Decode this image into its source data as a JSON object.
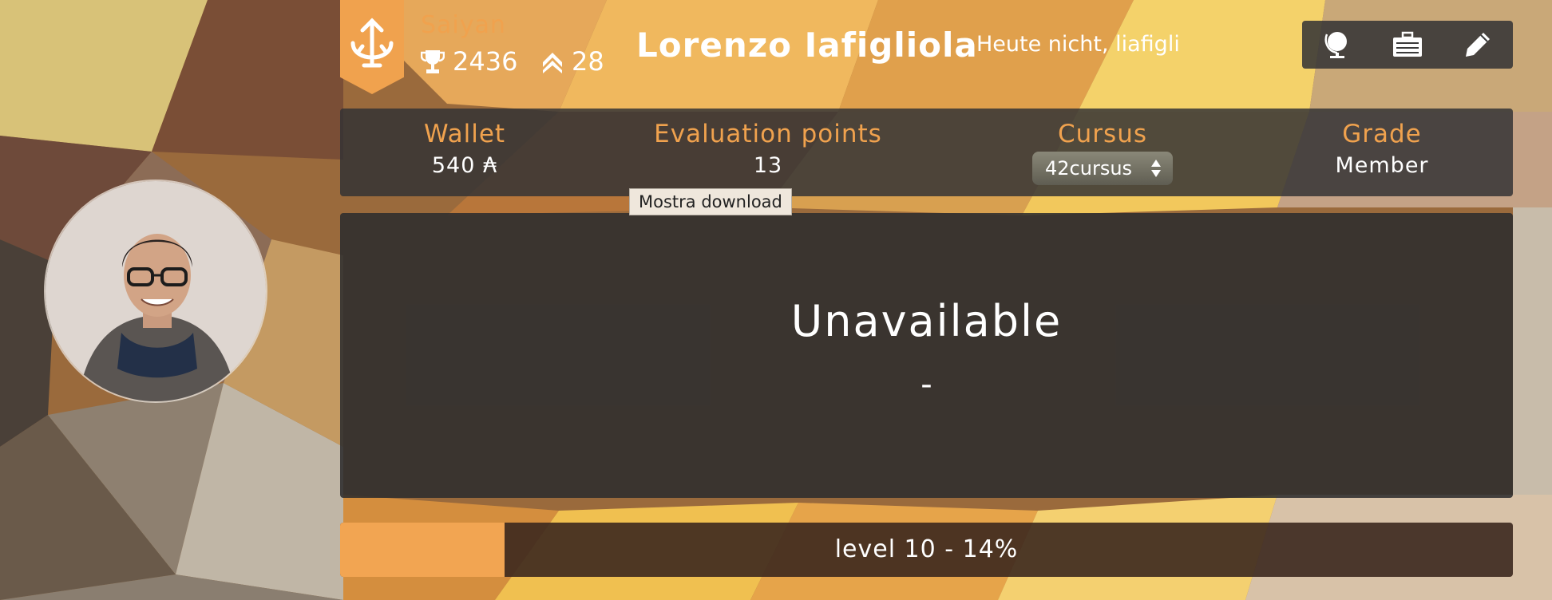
{
  "header": {
    "coalition": "Saiyan",
    "coalition_score": "2436",
    "rank": "28",
    "login_name": "Lorenzo Iafigliola",
    "location": "Heute nicht, liafigli"
  },
  "toolbar": {
    "items": [
      {
        "icon": "globe-icon"
      },
      {
        "icon": "briefcase-icon"
      },
      {
        "icon": "pencil-icon"
      }
    ]
  },
  "info": {
    "wallet": {
      "label": "Wallet",
      "value": "540 ₳"
    },
    "evaluation": {
      "label": "Evaluation points",
      "value": "13"
    },
    "cursus": {
      "label": "Cursus",
      "value": "42cursus"
    },
    "grade": {
      "label": "Grade",
      "value": "Member"
    }
  },
  "tooltip": "Mostra download",
  "main": {
    "title": "Unavailable",
    "subtitle": "-"
  },
  "level": {
    "text": "level 10 - 14%",
    "progress": 0.14
  },
  "colors": {
    "accent": "#f0a24e",
    "panel": "#323234"
  }
}
